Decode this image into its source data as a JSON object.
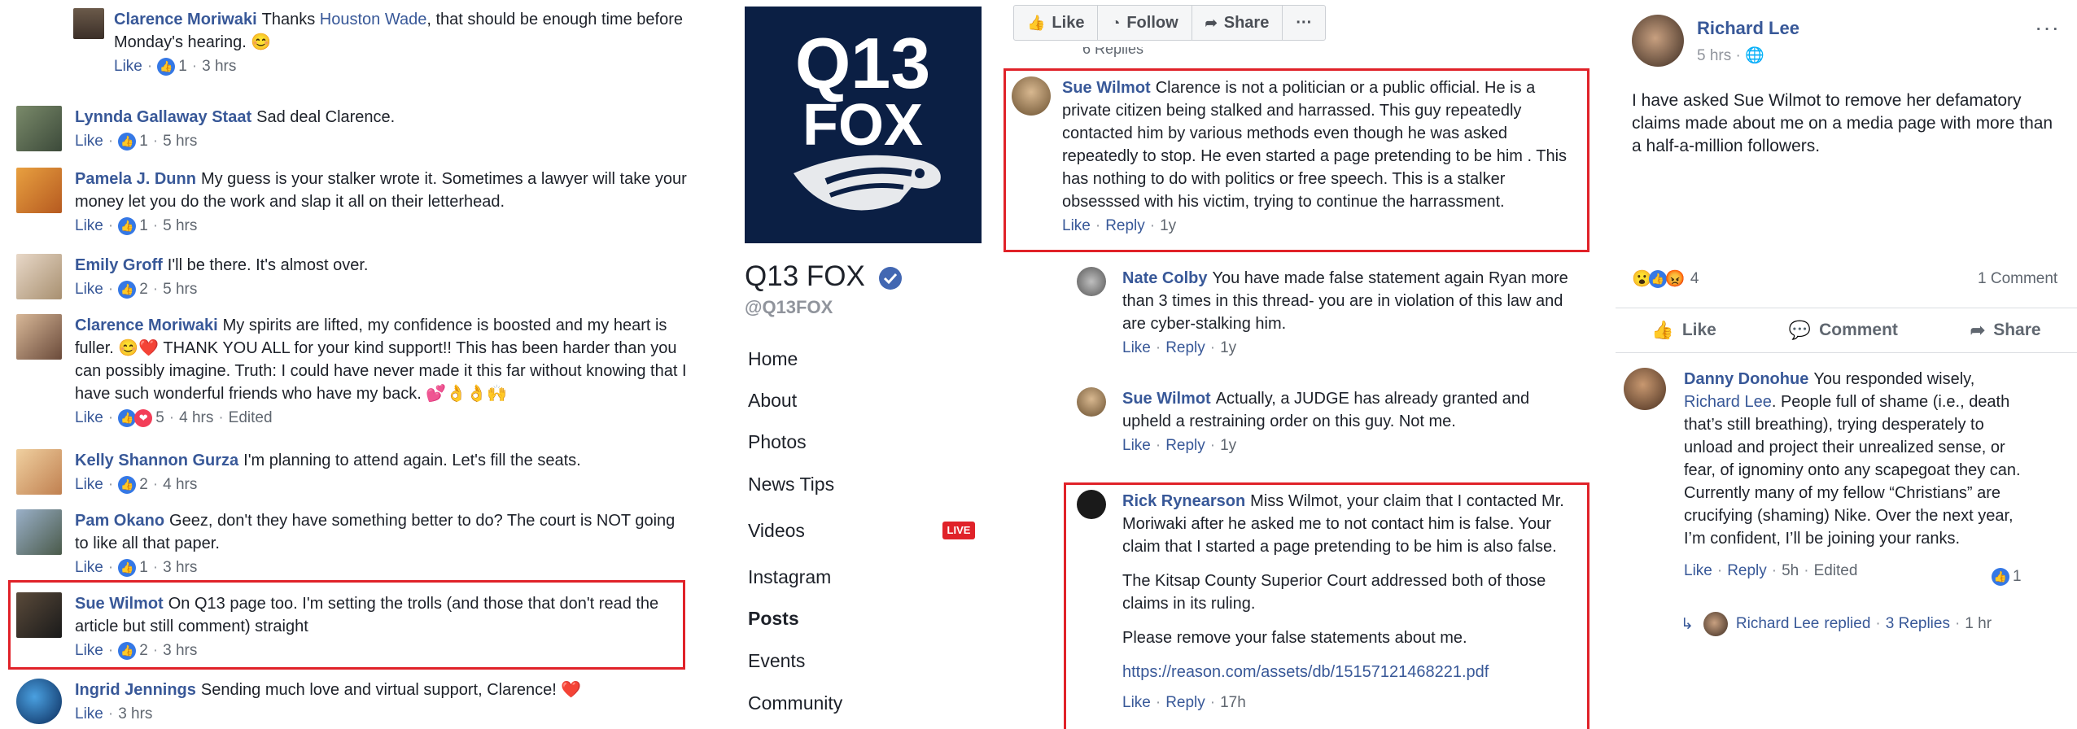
{
  "left_comments": [
    {
      "name": "Clarence Moriwaki",
      "text_a": "Thanks ",
      "mention": "Houston Wade",
      "text_b": ", that should be enough time before Monday's hearing. 😊",
      "like": "Like",
      "count": "1",
      "time": "3 hrs"
    },
    {
      "name": "Lynnda Gallaway Staat",
      "text": "Sad deal Clarence.",
      "like": "Like",
      "count": "1",
      "time": "5 hrs"
    },
    {
      "name": "Pamela J. Dunn",
      "text": "My guess is your stalker wrote it. Sometimes a lawyer will take your money let you do the work and slap it all on their letterhead.",
      "like": "Like",
      "count": "1",
      "time": "5 hrs"
    },
    {
      "name": "Emily Groff",
      "text": "I'll be there. It's almost over.",
      "like": "Like",
      "count": "2",
      "time": "5 hrs"
    },
    {
      "name": "Clarence Moriwaki",
      "text": "My spirits are lifted, my confidence is boosted and my heart is fuller. 😊❤️ THANK YOU ALL for your kind support!! This has been harder than you can possibly imagine. Truth: I could have never made it this far without knowing that I have such wonderful friends who have my back. 💕👌👌🙌",
      "like": "Like",
      "count": "5",
      "time": "4 hrs",
      "edited": "Edited"
    },
    {
      "name": "Kelly Shannon Gurza",
      "text": "I'm planning to attend again. Let's fill the seats.",
      "like": "Like",
      "count": "2",
      "time": "4 hrs"
    },
    {
      "name": "Pam Okano",
      "text": "Geez, don't they have something better to do? The court is NOT going to like all that paper.",
      "like": "Like",
      "count": "1",
      "time": "3 hrs"
    },
    {
      "name": "Sue Wilmot",
      "text": "On Q13 page too. I'm setting the trolls (and those that don't read the article but still comment) straight",
      "like": "Like",
      "count": "2",
      "time": "3 hrs"
    },
    {
      "name": "Ingrid Jennings",
      "text": "Sending much love and virtual support, Clarence! ❤️",
      "like": "Like",
      "time": "3 hrs"
    }
  ],
  "page": {
    "logo_line1": "Q13",
    "logo_line2": "FOX",
    "name": "Q13 FOX",
    "handle": "@Q13FOX",
    "nav": [
      "Home",
      "About",
      "Photos",
      "News Tips",
      "Videos",
      "Instagram",
      "Posts",
      "Events",
      "Community"
    ],
    "live": "LIVE"
  },
  "toolbar": {
    "like": "Like",
    "follow": "Follow",
    "share": "Share",
    "more": "···"
  },
  "replies_cut": "6 Replies",
  "mid_comments": [
    {
      "name": "Sue Wilmot",
      "text": "Clarence is not a politician or a public official. He is a private citizen being stalked and harrassed. This guy repeatedly contacted him by various methods even though he was asked repeatedly to stop. He even started a page pretending to be him . This has nothing to do with politics or free speech. This is a stalker obsesssed with his victim, trying to continue the harrassment.",
      "like": "Like",
      "reply": "Reply",
      "time": "1y"
    },
    {
      "name": "Nate Colby",
      "text": "You have made false statement again Ryan more than 3 times in this thread- you are in violation of this law and are cyber-stalking him.",
      "like": "Like",
      "reply": "Reply",
      "time": "1y"
    },
    {
      "name": "Sue Wilmot",
      "text": "Actually, a JUDGE has already granted and upheld a restraining order on this guy. Not me.",
      "like": "Like",
      "reply": "Reply",
      "time": "1y"
    },
    {
      "name": "Rick Rynearson",
      "text": "Miss Wilmot, your claim that I contacted Mr. Moriwaki after he asked me to not contact him is false. Your claim that I started a page pretending to be him is also false.",
      "p2": "The Kitsap County Superior Court addressed both of those claims in its ruling.",
      "p3": "Please remove your false statements about me.",
      "link": "https://reason.com/assets/db/15157121468221.pdf",
      "like": "Like",
      "reply": "Reply",
      "time": "17h"
    }
  ],
  "post": {
    "name": "Richard Lee",
    "time": "5 hrs",
    "more": "···",
    "text": "I have asked Sue Wilmot to remove her defamatory claims made about me on a media page with more than a half-a-million followers.",
    "reactions": "4",
    "comments": "1 Comment",
    "like": "Like",
    "comment": "Comment",
    "share": "Share"
  },
  "post_comment": {
    "name": "Danny Donohue",
    "text_a": "You responded wisely, ",
    "mention": "Richard Lee",
    "text_b": ". People full of shame (i.e., death that’s still breathing), trying desperately to unload and project their unrealized sense, or fear, of ignominy onto any scapegoat they can. Currently many of my fellow “Christians” are crucifying (shaming) Nike. Over the next year, I’m confident, I’ll be joining your ranks.",
    "like": "Like",
    "reply": "Reply",
    "time": "5h",
    "edited": "Edited",
    "count": "1",
    "replied_name": "Richard Lee",
    "replied_text": "replied",
    "replies": "3 Replies",
    "replies_time": "1 hr"
  },
  "colors": {
    "link": "#385898",
    "highlight": "#e02229",
    "like_blue": "#3578e5"
  }
}
